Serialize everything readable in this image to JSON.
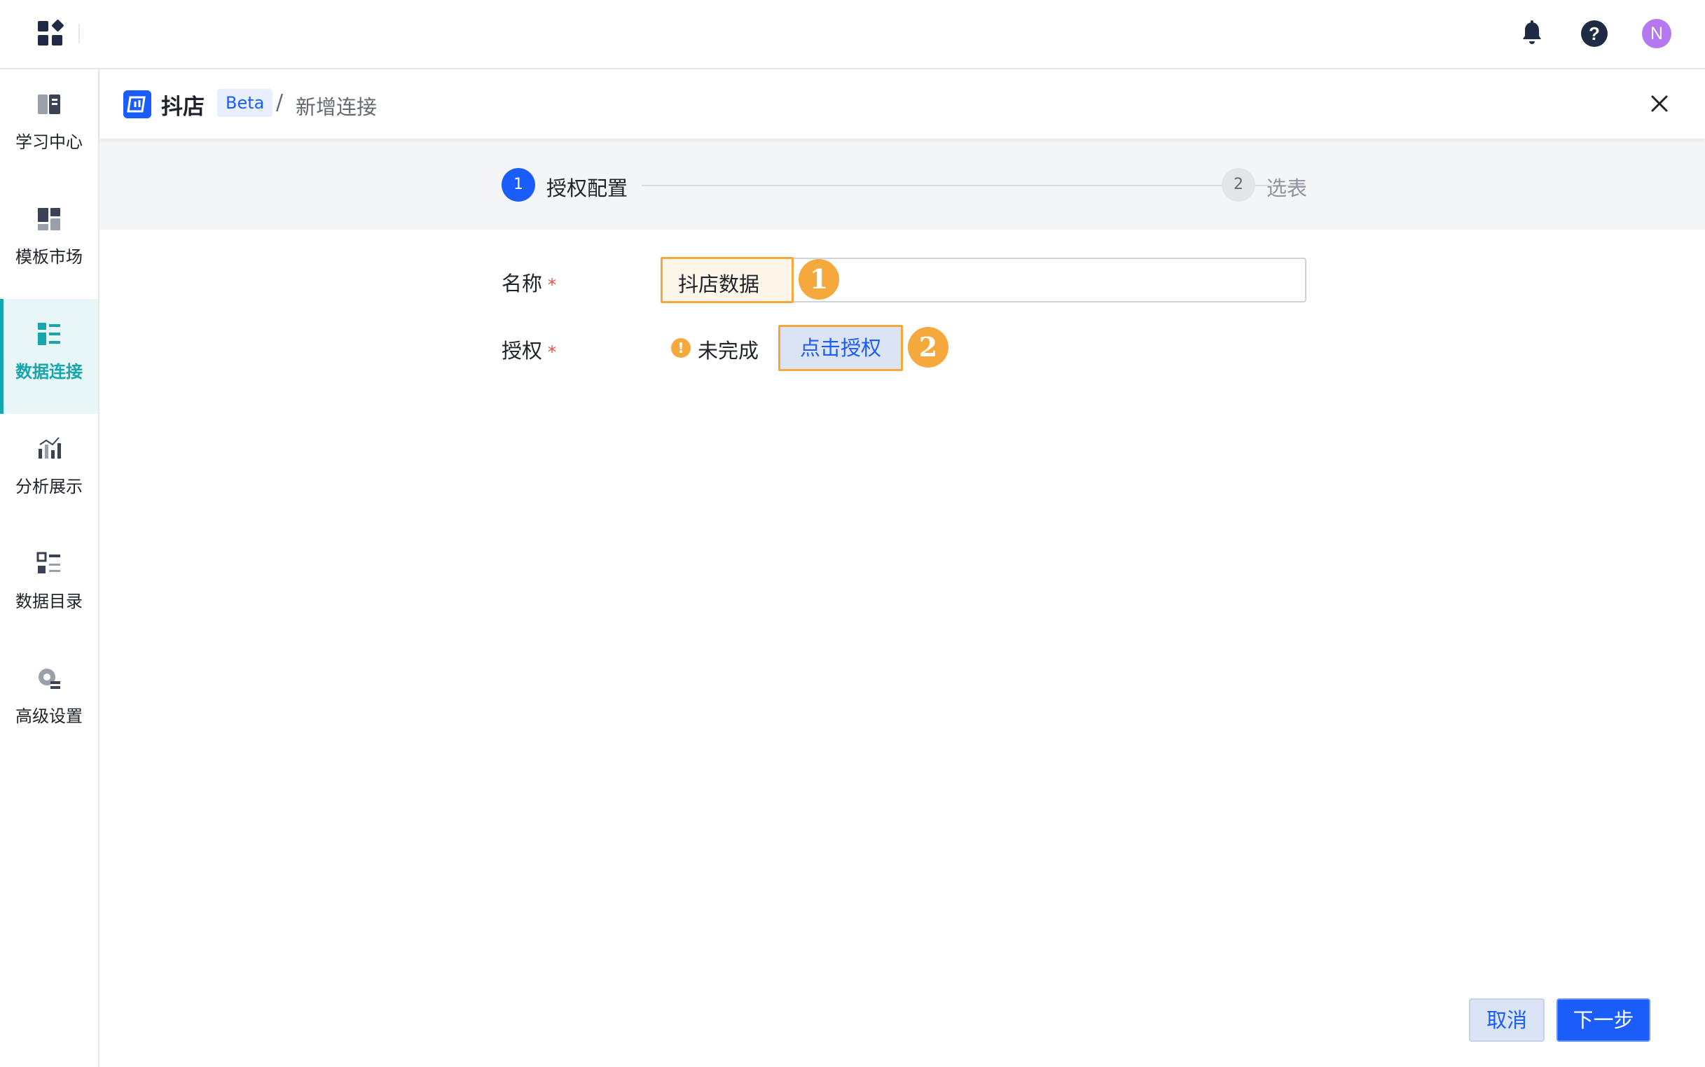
{
  "topbar": {
    "app_menu_icon": "app-grid-icon",
    "notification_icon": "bell-icon",
    "help_icon": "question-circle-icon",
    "avatar_initial": "N",
    "avatar_color": "#b678ee"
  },
  "sidebar": {
    "items": [
      {
        "label": "学习中心",
        "icon": "book-icon",
        "active": false
      },
      {
        "label": "模板市场",
        "icon": "template-grid-icon",
        "active": false
      },
      {
        "label": "数据连接",
        "icon": "data-connection-icon",
        "active": true
      },
      {
        "label": "分析展示",
        "icon": "bar-chart-icon",
        "active": false
      },
      {
        "label": "数据目录",
        "icon": "catalog-list-icon",
        "active": false
      },
      {
        "label": "高级设置",
        "icon": "gear-icon",
        "active": false
      }
    ],
    "active_color": "#16a6ae"
  },
  "header": {
    "brand_name": "抖店",
    "badge": "Beta",
    "separator": "/",
    "page_title": "新增连接",
    "close_icon": "close-icon"
  },
  "steps": [
    {
      "number": "1",
      "label": "授权配置",
      "state": "current"
    },
    {
      "number": "2",
      "label": "选表",
      "state": "pending"
    }
  ],
  "form": {
    "name": {
      "label": "名称",
      "required_mark": "*",
      "value": "抖店数据"
    },
    "auth": {
      "label": "授权",
      "required_mark": "*",
      "status_icon": "warning-icon",
      "status_text": "未完成",
      "button_label": "点击授权"
    }
  },
  "callouts": {
    "first": "1",
    "second": "2",
    "color": "#f5a93c"
  },
  "footer": {
    "cancel_label": "取消",
    "next_label": "下一步"
  },
  "colors": {
    "primary": "#1a5dfb",
    "accent_teal": "#16a6ae",
    "highlight": "#f5a93c"
  }
}
